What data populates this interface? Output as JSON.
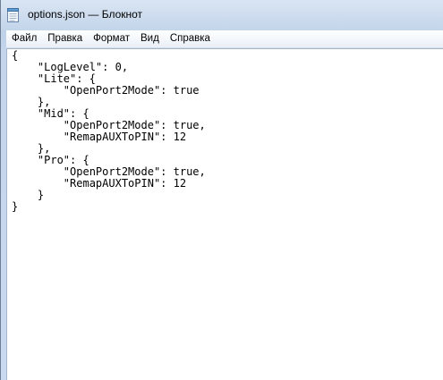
{
  "window": {
    "title": "options.json — Блокнот"
  },
  "menu": {
    "file": "Файл",
    "edit": "Правка",
    "format": "Формат",
    "view": "Вид",
    "help": "Справка"
  },
  "icons": {
    "app": "notepad-icon"
  },
  "editor": {
    "content": "{\n    \"LogLevel\": 0,\n    \"Lite\": {\n        \"OpenPort2Mode\": true\n    },\n    \"Mid\": {\n        \"OpenPort2Mode\": true,\n        \"RemapAUXToPIN\": 12\n    },\n    \"Pro\": {\n        \"OpenPort2Mode\": true,\n        \"RemapAUXToPIN\": 12\n    }\n}"
  }
}
